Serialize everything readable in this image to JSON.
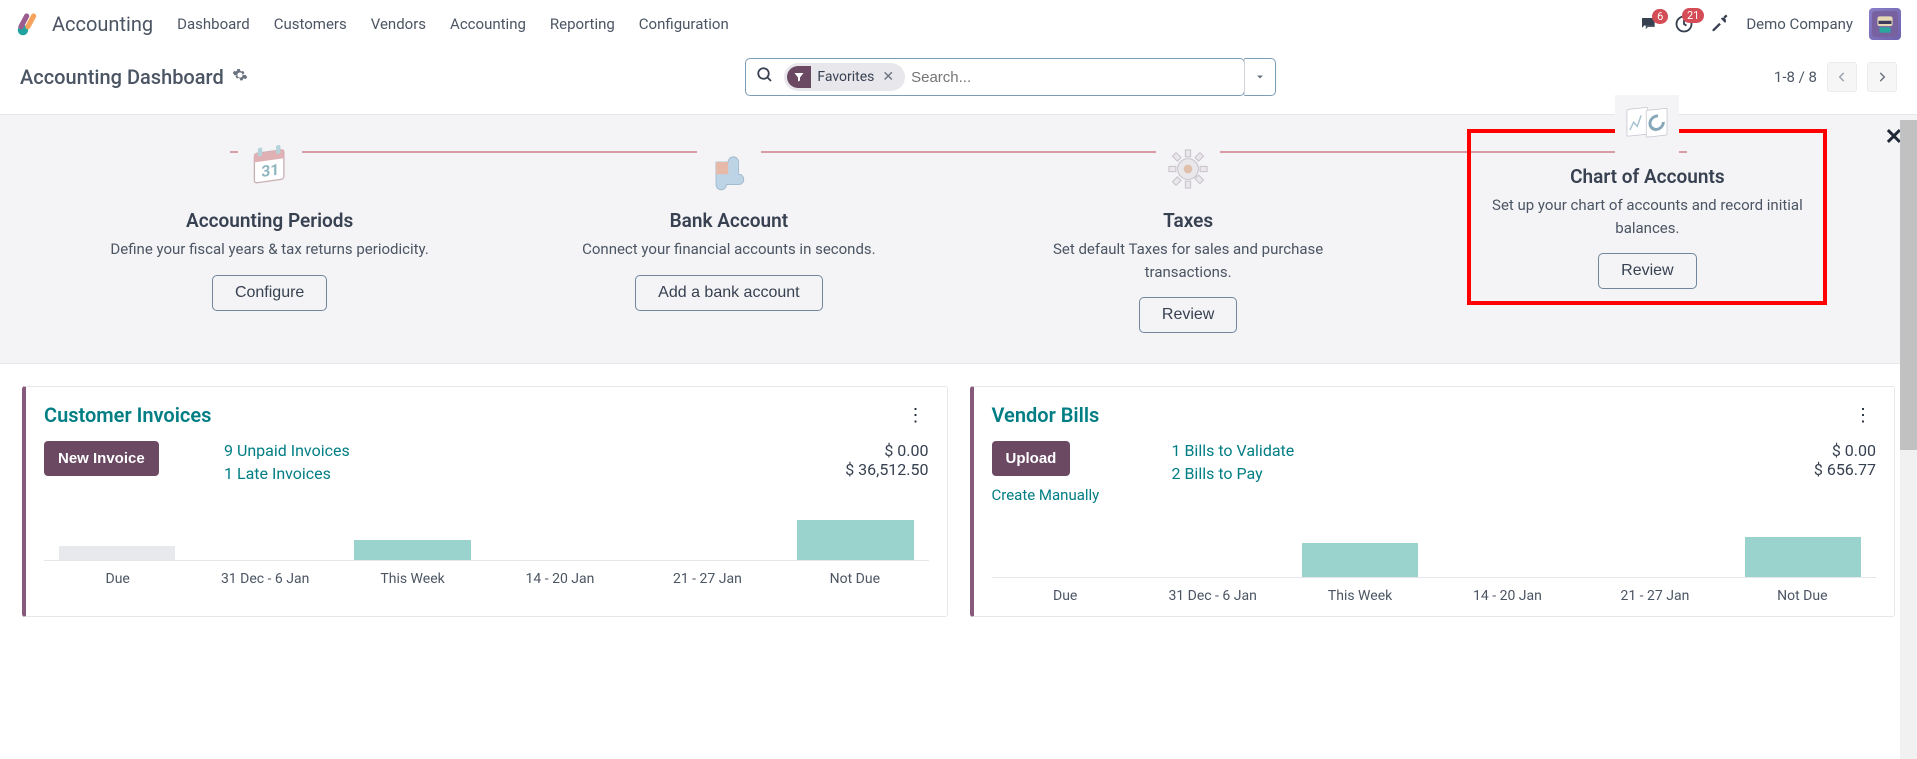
{
  "topbar": {
    "app_name": "Accounting",
    "menu": [
      "Dashboard",
      "Customers",
      "Vendors",
      "Accounting",
      "Reporting",
      "Configuration"
    ],
    "chat_badge": "6",
    "clock_badge": "21",
    "company": "Demo Company"
  },
  "subheader": {
    "title": "Accounting Dashboard",
    "filter_chip": "Favorites",
    "search_placeholder": "Search...",
    "pager": "1-8 / 8"
  },
  "onboard": {
    "steps": [
      {
        "title": "Accounting Periods",
        "desc": "Define your fiscal years & tax returns periodicity.",
        "btn": "Configure"
      },
      {
        "title": "Bank Account",
        "desc": "Connect your financial accounts in seconds.",
        "btn": "Add a bank account"
      },
      {
        "title": "Taxes",
        "desc": "Set default Taxes for sales and purchase transactions.",
        "btn": "Review"
      },
      {
        "title": "Chart of Accounts",
        "desc": "Set up your chart of accounts and record initial balances.",
        "btn": "Review"
      }
    ]
  },
  "cards": {
    "customer": {
      "title": "Customer Invoices",
      "btn": "New Invoice",
      "link1": "9 Unpaid Invoices",
      "link2": "1 Late Invoices",
      "amt1": "$ 0.00",
      "amt2": "$ 36,512.50"
    },
    "vendor": {
      "title": "Vendor Bills",
      "btn": "Upload",
      "btn_secondary": "Create Manually",
      "link1": "1 Bills to Validate",
      "link2": "2 Bills to Pay",
      "amt1": "$ 0.00",
      "amt2": "$ 656.77"
    }
  },
  "chart_data": [
    {
      "type": "bar",
      "title": "Customer Invoices",
      "categories": [
        "Due",
        "31 Dec - 6 Jan",
        "This Week",
        "14 - 20 Jan",
        "21 - 27 Jan",
        "Not Due"
      ],
      "values": [
        0,
        0,
        12000,
        0,
        0,
        24000
      ],
      "faded": [
        true,
        false,
        false,
        false,
        false,
        false
      ],
      "ylabel": "",
      "xlabel": ""
    },
    {
      "type": "bar",
      "title": "Vendor Bills",
      "categories": [
        "Due",
        "31 Dec - 6 Jan",
        "This Week",
        "14 - 20 Jan",
        "21 - 27 Jan",
        "Not Due"
      ],
      "values": [
        0,
        0,
        300,
        0,
        0,
        357
      ],
      "faded": [
        false,
        false,
        false,
        false,
        false,
        false
      ],
      "ylabel": "",
      "xlabel": ""
    }
  ]
}
